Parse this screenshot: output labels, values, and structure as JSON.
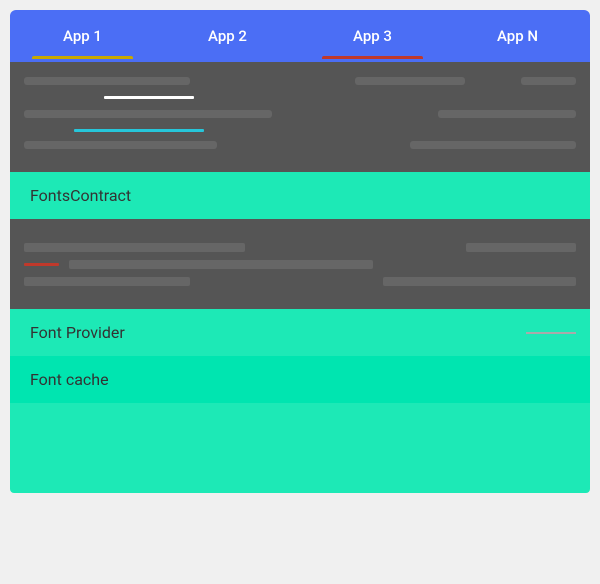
{
  "appBar": {
    "tabs": [
      {
        "id": "app1",
        "label": "App 1",
        "active": true
      },
      {
        "id": "app2",
        "label": "App 2",
        "active": false
      },
      {
        "id": "app3",
        "label": "App 3",
        "active": false
      },
      {
        "id": "appN",
        "label": "App N",
        "active": false
      }
    ]
  },
  "boxes": {
    "fontsContract": "FontsContract",
    "fontProvider": "Font Provider",
    "fontCache": "Font cache"
  },
  "colors": {
    "appBar": "#4b6ef5",
    "darkSection": "#555555",
    "teal": "#1de9b6",
    "tealDark": "#00e5b0"
  }
}
